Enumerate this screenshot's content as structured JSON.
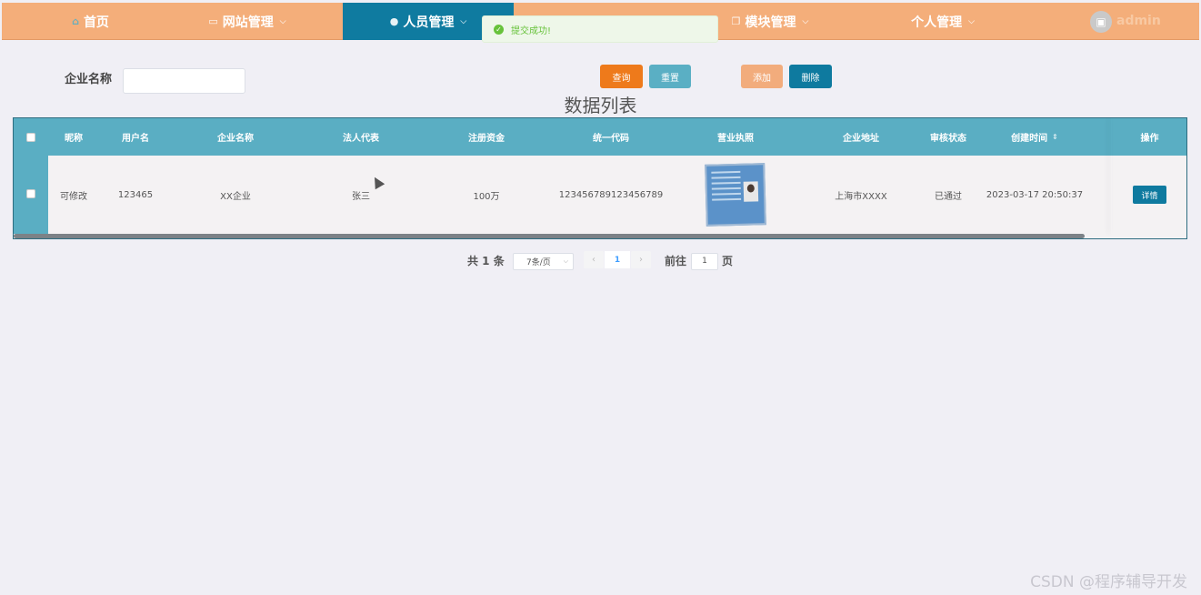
{
  "nav": {
    "items": [
      {
        "label": "首页",
        "icon": "home-icon",
        "caret": false,
        "active": false
      },
      {
        "label": "网站管理",
        "icon": "monitor-icon",
        "caret": true,
        "active": false
      },
      {
        "label": "人员管理",
        "icon": "user-icon",
        "caret": true,
        "active": true
      },
      {
        "label": "模块管理",
        "icon": "copy-icon",
        "caret": true,
        "active": false
      },
      {
        "label": "个人管理",
        "icon": "",
        "caret": true,
        "active": false
      }
    ],
    "user": "admin",
    "avatar_icon": "image-icon"
  },
  "toast": {
    "text": "提交成功!",
    "icon": "check-circle-icon",
    "color": "#67c23a"
  },
  "search": {
    "label": "企业名称",
    "value": "",
    "placeholder": ""
  },
  "buttons": {
    "query": "查询",
    "reset": "重置",
    "add": "添加",
    "delete": "删除"
  },
  "list_title": "数据列表",
  "table": {
    "headers": [
      "昵称",
      "用户名",
      "企业名称",
      "法人代表",
      "注册资金",
      "统一代码",
      "营业执照",
      "企业地址",
      "审核状态",
      "创建时间",
      "操作"
    ],
    "rows": [
      {
        "nickname": "可修改",
        "username": "123465",
        "company": "XX企业",
        "legal_rep": "张三",
        "capital": "100万",
        "code": "123456789123456789",
        "address": "上海市XXXX",
        "status": "已通过",
        "created": "2023-03-17 20:50:37",
        "action": "详情"
      }
    ]
  },
  "pagination": {
    "total": "共 1 条",
    "page_size": "7条/页",
    "current_page": "1",
    "goto_label": "前往",
    "goto_value": "1",
    "unit": "页"
  },
  "watermark": "CSDN @程序辅导开发",
  "colors": {
    "nav_bg": "#f4ae7a",
    "nav_active": "#0f7ba0",
    "table_header": "#5aaec3",
    "query_btn": "#ee7a1b",
    "reset_btn": "#5aafc4",
    "add_btn": "#f2ac7c",
    "delete_btn": "#0e7a9f"
  }
}
